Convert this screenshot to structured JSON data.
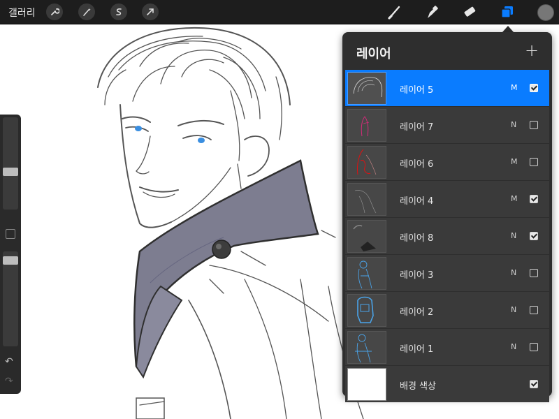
{
  "toolbar": {
    "gallery_label": "갤러리",
    "left_tools": [
      "wrench-icon",
      "magic-wand-icon",
      "selection-s-icon",
      "transform-arrow-icon"
    ],
    "right_tools": [
      "brush-icon",
      "smudge-icon",
      "eraser-icon",
      "layers-icon"
    ],
    "active_tool": "layers-icon",
    "active_color": "#777777",
    "accent_color": "#0a7cff"
  },
  "sidebar": {
    "brush_size_level": 0.4,
    "opacity_level": 0.05,
    "undo_icon": "undo-icon",
    "redo_icon": "redo-icon"
  },
  "layers_panel": {
    "title": "레이어",
    "add_symbol": "+",
    "layers": [
      {
        "name": "레이어 5",
        "mode": "M",
        "visible": true,
        "active": true
      },
      {
        "name": "레이어 7",
        "mode": "N",
        "visible": false,
        "active": false
      },
      {
        "name": "레이어 6",
        "mode": "M",
        "visible": false,
        "active": false
      },
      {
        "name": "레이어 4",
        "mode": "M",
        "visible": true,
        "active": false
      },
      {
        "name": "레이어 8",
        "mode": "N",
        "visible": true,
        "active": false
      },
      {
        "name": "레이어 3",
        "mode": "N",
        "visible": false,
        "active": false
      },
      {
        "name": "레이어 2",
        "mode": "N",
        "visible": false,
        "active": false
      },
      {
        "name": "레이어 1",
        "mode": "N",
        "visible": false,
        "active": false
      }
    ],
    "background": {
      "name": "배경 색상",
      "visible": true,
      "color": "#ffffff"
    }
  }
}
